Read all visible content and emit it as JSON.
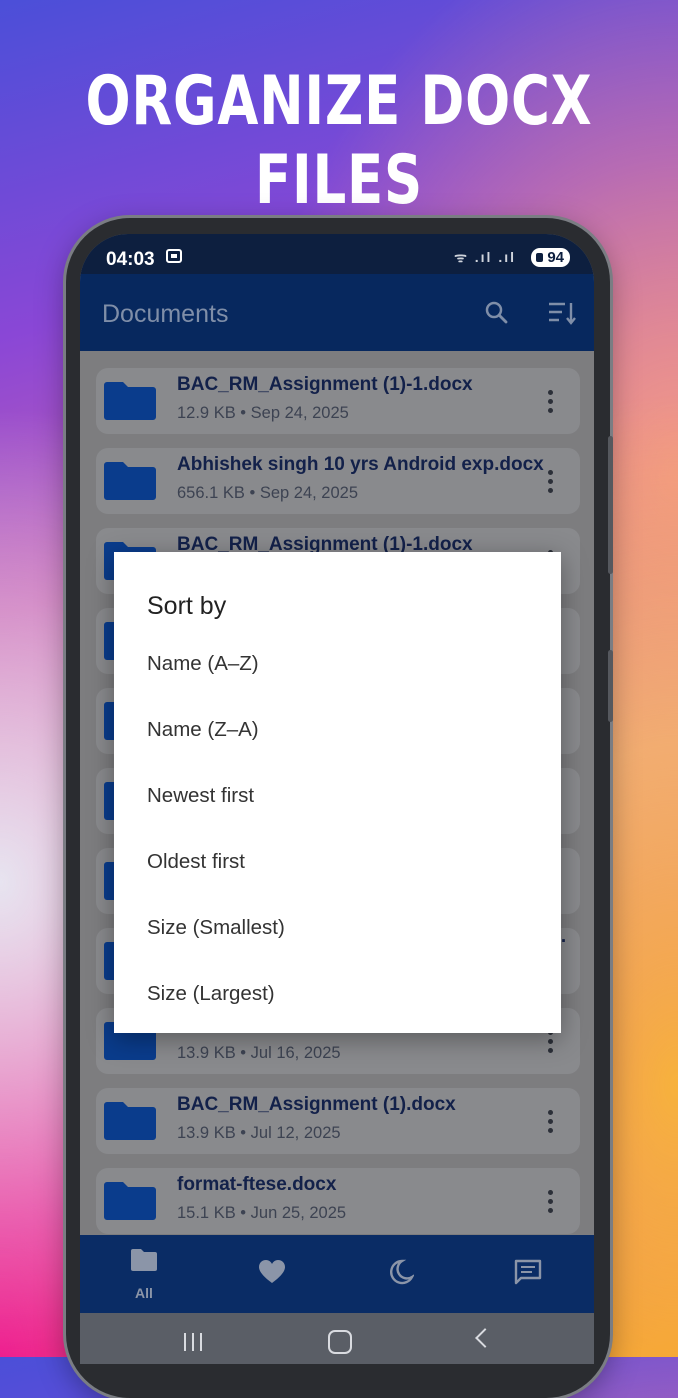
{
  "headline": "ORGANIZE DOCX FILES",
  "status": {
    "time": "04:03",
    "signal": "ᯤ .ıl .ıl",
    "battery": "94"
  },
  "appbar": {
    "title": "Documents"
  },
  "files": [
    {
      "name": "BAC_RM_Assignment (1)-1.docx",
      "meta": "12.9 KB • Sep 24, 2025"
    },
    {
      "name": "Abhishek singh 10 yrs Android exp.docx",
      "meta": "656.1 KB • Sep 24, 2025"
    },
    {
      "name": "BAC_RM_Assignment (1)-1.docx",
      "meta": ""
    },
    {
      "name": "",
      "meta": ""
    },
    {
      "name": "",
      "meta": ""
    },
    {
      "name": "",
      "meta": ""
    },
    {
      "name": "",
      "meta": ""
    },
    {
      "name": "…",
      "meta": ""
    },
    {
      "name": "",
      "meta": "13.9 KB • Jul 16, 2025"
    },
    {
      "name": "BAC_RM_Assignment (1).docx",
      "meta": "13.9 KB • Jul 12, 2025"
    },
    {
      "name": "format-ftese.docx",
      "meta": "15.1 KB • Jun 25, 2025"
    }
  ],
  "nav": [
    {
      "label": "All",
      "icon": "folder-icon"
    },
    {
      "label": "",
      "icon": "heart-icon"
    },
    {
      "label": "",
      "icon": "moon-icon"
    },
    {
      "label": "",
      "icon": "message-icon"
    }
  ],
  "sort_dialog": {
    "title": "Sort by",
    "options": [
      "Name (A–Z)",
      "Name (Z–A)",
      "Newest first",
      "Oldest first",
      "Size (Smallest)",
      "Size (Largest)"
    ]
  },
  "colors": {
    "appbar": "#07285e",
    "folder": "#0a3c8c",
    "scrim": "#7d7d7f",
    "dialog": "#ffffff"
  }
}
